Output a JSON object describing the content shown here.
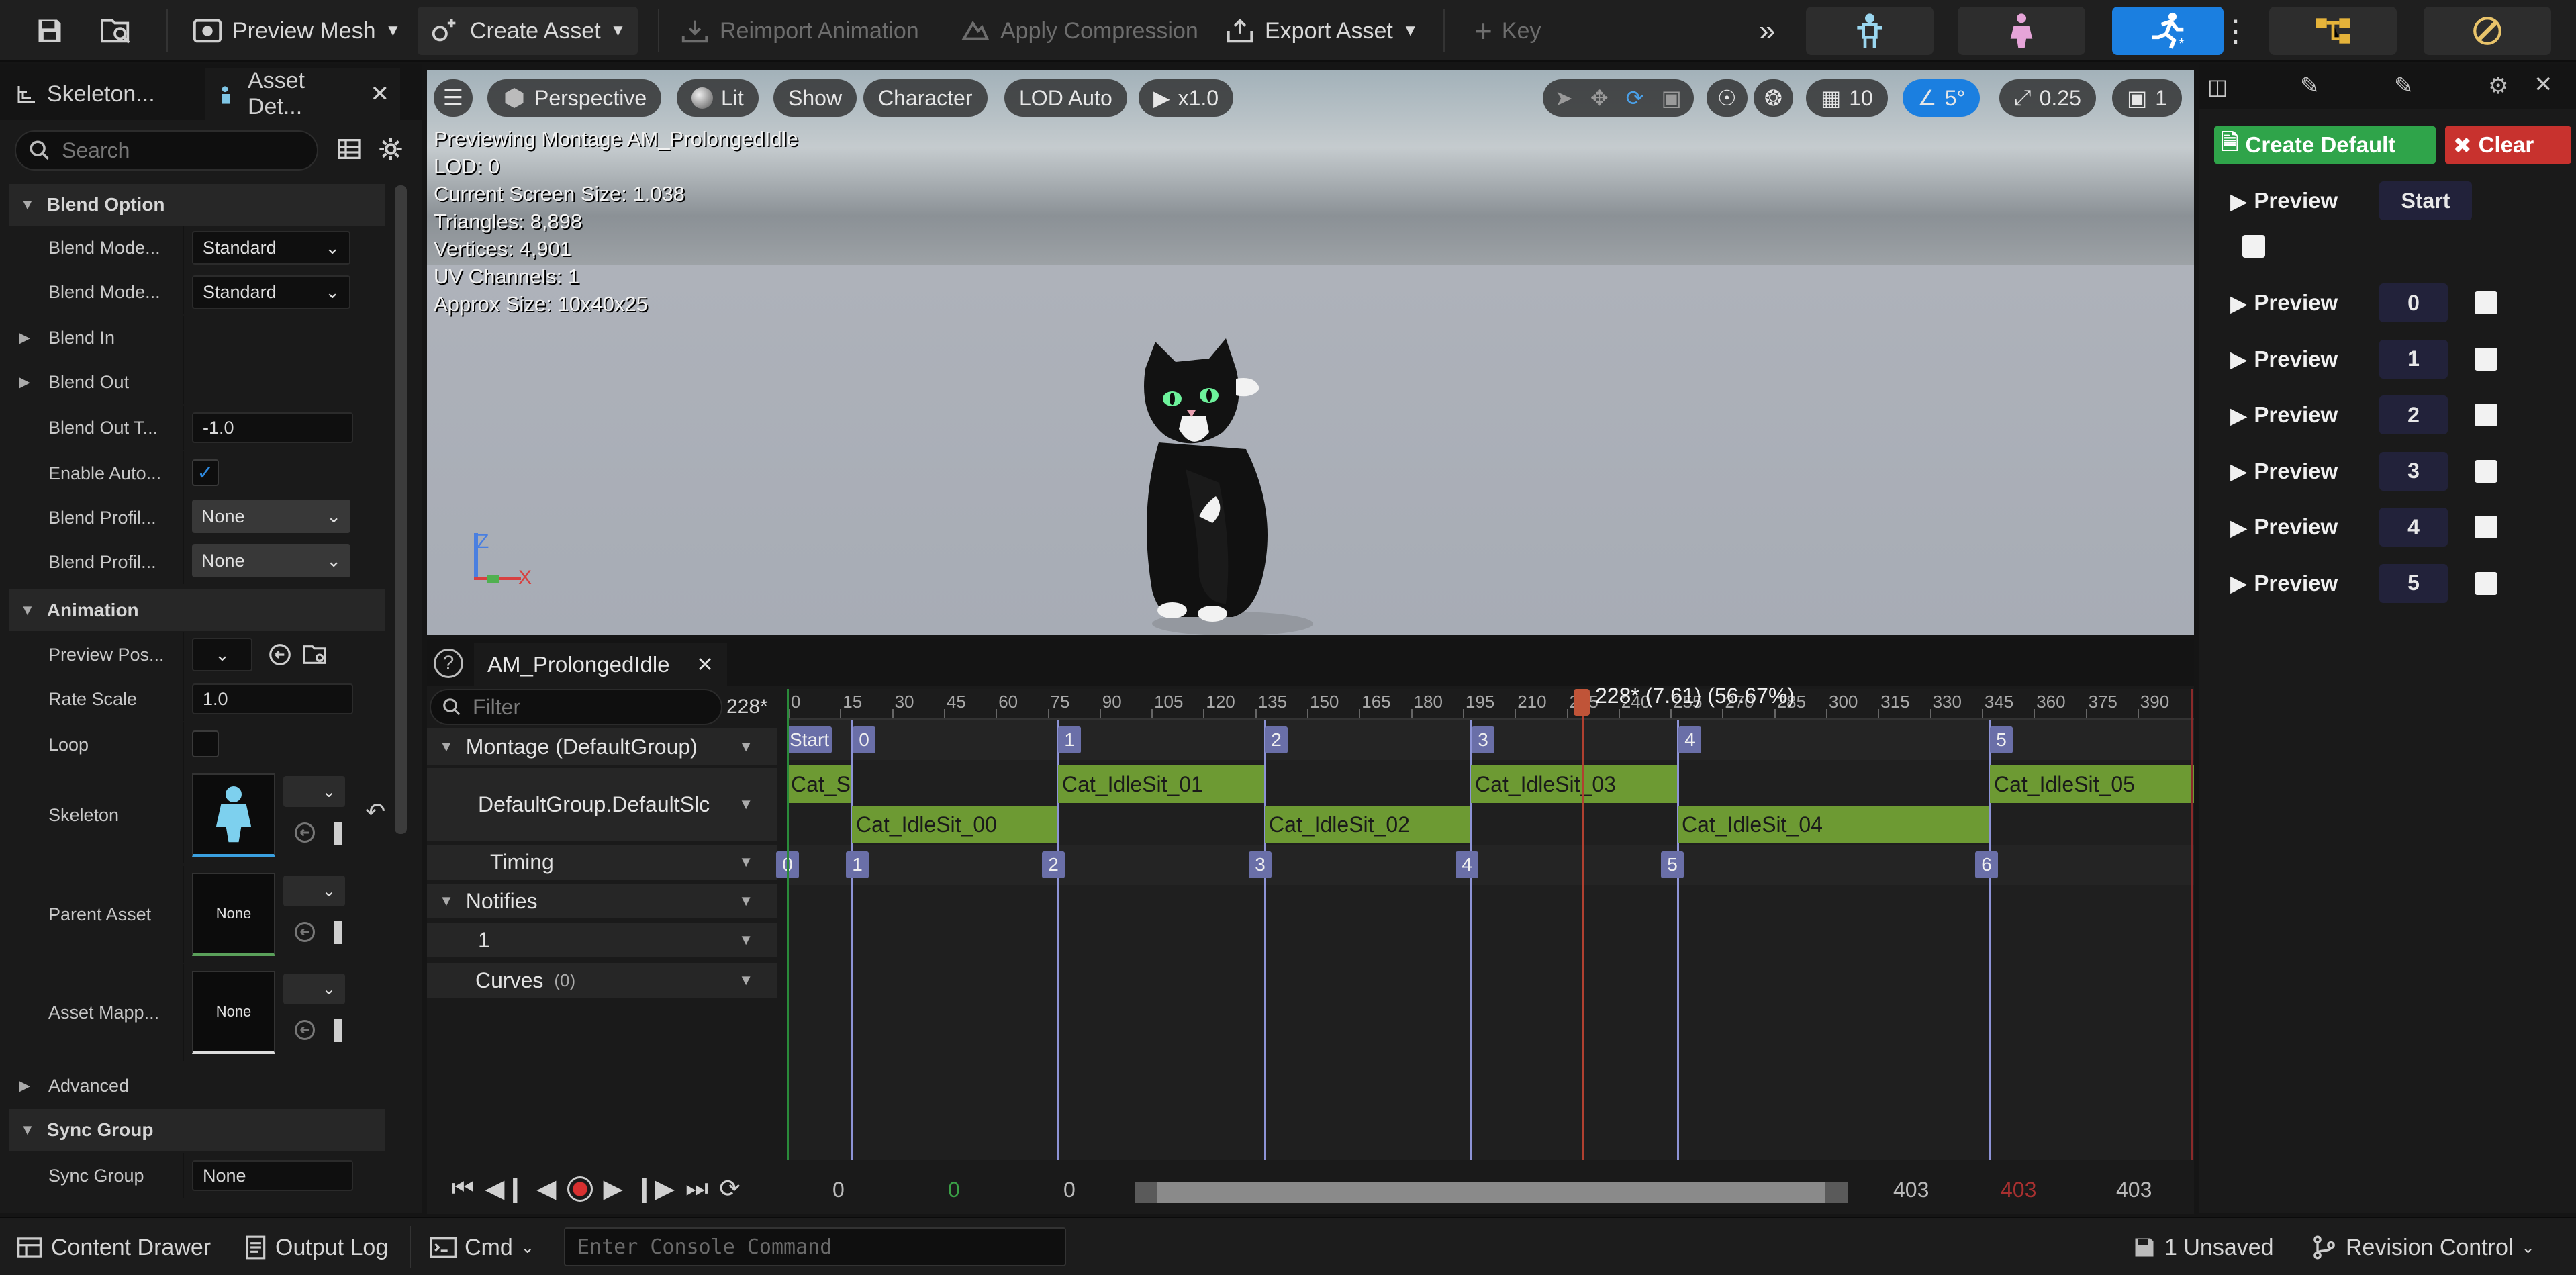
{
  "toolbar": {
    "preview_mesh": "Preview Mesh",
    "create_asset": "Create Asset",
    "reimport_animation": "Reimport Animation",
    "apply_compression": "Apply Compression",
    "export_asset": "Export Asset",
    "key": "Key"
  },
  "left_tabs": {
    "skeleton": "Skeleton...",
    "asset_details": "Asset Det..."
  },
  "details": {
    "search_placeholder": "Search",
    "blend_option": "Blend Option",
    "blend_mode_1_label": "Blend Mode...",
    "blend_mode_1_value": "Standard",
    "blend_mode_2_label": "Blend Mode...",
    "blend_mode_2_value": "Standard",
    "blend_in": "Blend In",
    "blend_out": "Blend Out",
    "blend_out_t_label": "Blend Out T...",
    "blend_out_t_value": "-1.0",
    "enable_auto_label": "Enable Auto...",
    "blend_profile_1_label": "Blend Profil...",
    "blend_profile_1_value": "None",
    "blend_profile_2_label": "Blend Profil...",
    "blend_profile_2_value": "None",
    "animation": "Animation",
    "preview_pos_label": "Preview Pos...",
    "rate_scale_label": "Rate Scale",
    "rate_scale_value": "1.0",
    "loop_label": "Loop",
    "skeleton_label": "Skeleton",
    "parent_asset_label": "Parent Asset",
    "parent_asset_value": "None",
    "asset_mapping_label": "Asset Mapp...",
    "asset_mapping_value": "None",
    "advanced": "Advanced",
    "sync_group_section": "Sync Group",
    "sync_group_label": "Sync Group",
    "sync_group_value": "None"
  },
  "viewport": {
    "perspective": "Perspective",
    "lit": "Lit",
    "show": "Show",
    "character": "Character",
    "lod_auto": "LOD Auto",
    "play_rate": "x1.0",
    "grid_size": "10",
    "rot_snap": "5°",
    "scale_snap": "0.25",
    "camera_speed": "1",
    "stats": [
      "Previewing Montage AM_ProlongedIdle",
      "LOD: 0",
      "Current Screen Size: 1.038",
      "Triangles: 8,898",
      "Vertices: 4,901",
      "UV Channels: 1",
      "Approx Size: 10x40x25"
    ],
    "axis_z": "Z",
    "axis_x": "X"
  },
  "sequencer": {
    "tab_name": "AM_ProlongedIdle",
    "filter_placeholder": "Filter",
    "frame_display": "228*",
    "montage_group": "Montage (DefaultGroup)",
    "slot_name": "DefaultGroup.DefaultSlc",
    "timing": "Timing",
    "notifies": "Notifies",
    "notify_track": "1",
    "curves": "Curves",
    "curves_count": "(0)",
    "playhead_label": "228* (7.61) (56.67%)",
    "ticks": [
      "0",
      "15",
      "30",
      "45",
      "60",
      "75",
      "90",
      "105",
      "120",
      "135",
      "150",
      "165",
      "180",
      "195",
      "210",
      "225",
      "240",
      "255",
      "270",
      "285",
      "300",
      "315",
      "330",
      "345",
      "360",
      "375",
      "390"
    ],
    "sections": [
      "Start",
      "0",
      "1",
      "2",
      "3",
      "4",
      "5"
    ],
    "clips_top": [
      "Cat_St",
      "Cat_IdleSit_01",
      "Cat_IdleSit_03",
      "Cat_IdleSit_05"
    ],
    "clips_bottom": [
      "Cat_IdleSit_00",
      "Cat_IdleSit_02",
      "Cat_IdleSit_04"
    ],
    "timing_markers": [
      "0",
      "1",
      "2",
      "3",
      "4",
      "5",
      "6"
    ],
    "range_start": "0",
    "range_start_green": "0",
    "range_view_start": "0",
    "range_view_end": "403",
    "range_end_red": "403",
    "range_end": "403"
  },
  "right_panel": {
    "create_default": "Create Default",
    "clear": "Clear",
    "preview_label": "Preview",
    "start": "Start",
    "section_rows": [
      "0",
      "1",
      "2",
      "3",
      "4",
      "5"
    ]
  },
  "status": {
    "content_drawer": "Content Drawer",
    "output_log": "Output Log",
    "cmd": "Cmd",
    "console_placeholder": "Enter Console Command",
    "unsaved": "1 Unsaved",
    "revision_control": "Revision Control"
  },
  "colors": {
    "clip_green": "#6d9a33",
    "marker_purple": "#6a6fa8",
    "create_default_green": "#2fa44a",
    "clear_red": "#c8322e",
    "accent_blue": "#1b7fe0"
  }
}
